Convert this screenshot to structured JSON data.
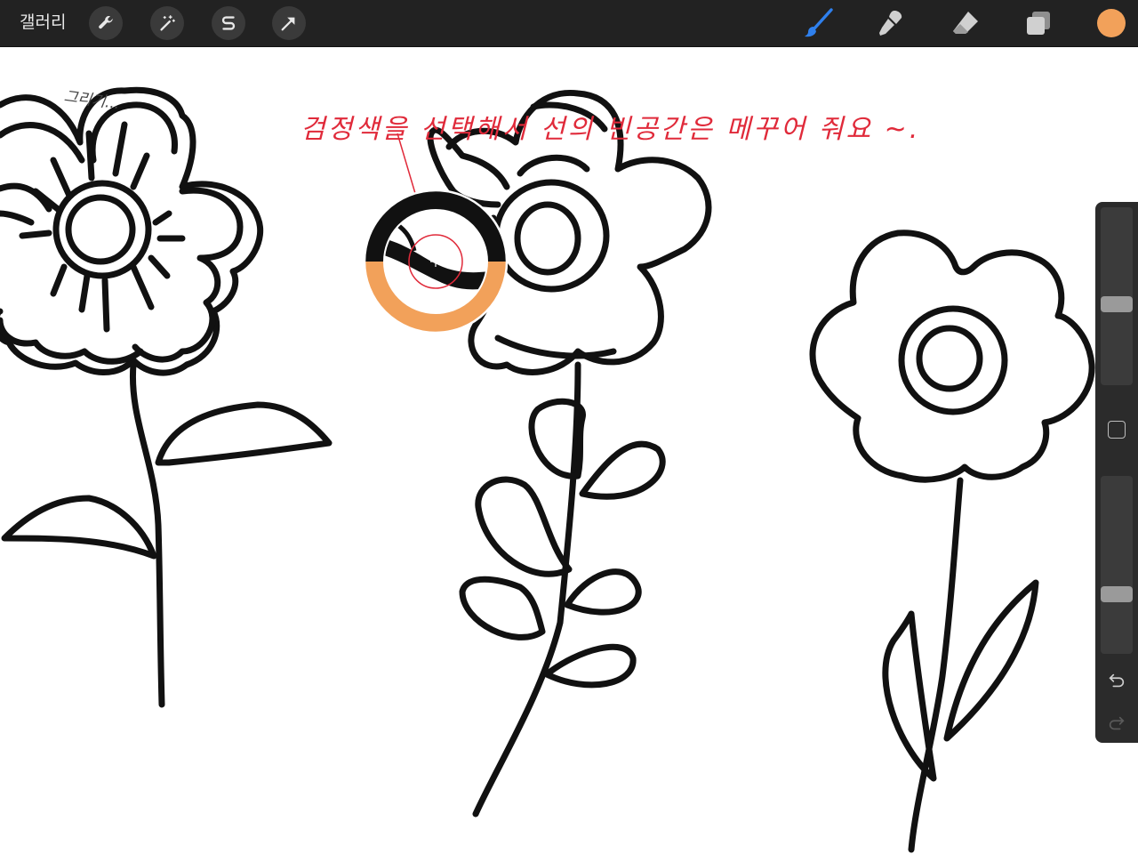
{
  "topbar": {
    "gallery_label": "갤러리",
    "left_tools": [
      {
        "name": "actions-wrench-icon"
      },
      {
        "name": "adjustments-magic-wand-icon"
      },
      {
        "name": "selection-s-icon"
      },
      {
        "name": "transform-arrow-icon"
      }
    ],
    "right_tools": [
      {
        "name": "brush-icon",
        "active": true
      },
      {
        "name": "smudge-icon"
      },
      {
        "name": "eraser-icon"
      },
      {
        "name": "layers-icon"
      }
    ],
    "current_color": "#f2a15a"
  },
  "canvas": {
    "annotation_text": "검정색을 선택해서 선의 빈공간은 메꾸어 줘요 ~.",
    "scribble_text": "그리기...",
    "annotation_color": "#e02a3a",
    "eyedropper": {
      "sampled_color": "#111111",
      "previous_color": "#f2a15a"
    }
  },
  "sidebar": {
    "brush_size_level": 0.45,
    "opacity_level": 0.32,
    "undo_icon": "undo-icon",
    "redo_icon": "redo-icon"
  },
  "colors": {
    "toolbar_bg": "#222222",
    "brush_active": "#2f80ed",
    "icon_gray": "#d0d0d0"
  }
}
